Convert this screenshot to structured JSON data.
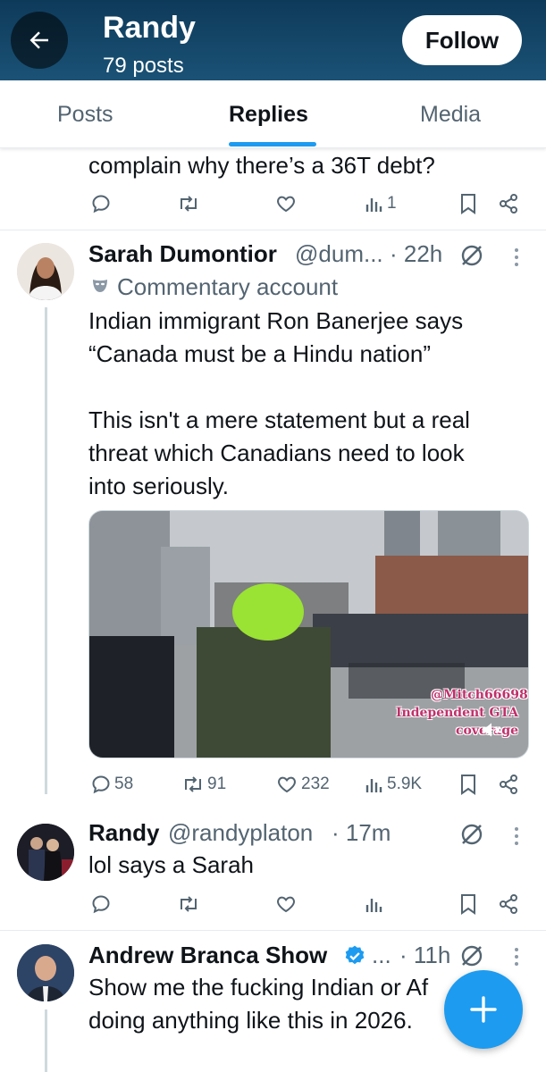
{
  "header": {
    "name": "Randy",
    "posts_count": "79 posts",
    "follow_label": "Follow",
    "back_icon": "arrow-left-icon"
  },
  "tabs": [
    {
      "label": "Posts",
      "active": false
    },
    {
      "label": "Replies",
      "active": true
    },
    {
      "label": "Media",
      "active": false
    }
  ],
  "previous_tweet": {
    "text_tail": "complain why there’s a 36T debt?",
    "views": "1"
  },
  "tweet_sarah": {
    "name": "Sarah Dumontior",
    "handle": "@dum...",
    "time": "· 22h",
    "label_text": "Commentary account",
    "lines": [
      "Indian immigrant Ron Banerjee says",
      "“Canada must be a Hindu nation”",
      "",
      "This isn't a mere statement but a real",
      "threat which Canadians need to look",
      "into seriously."
    ],
    "media_watermark": [
      "@Mitch66698·",
      "Independent GTA",
      "coverage"
    ],
    "replies": "58",
    "reposts": "91",
    "likes": "232",
    "views": "5.9K"
  },
  "tweet_randy": {
    "name": "Randy",
    "handle": "@randyplaton",
    "time": "· 17m",
    "text": "lol says a Sarah"
  },
  "tweet_andrew": {
    "name": "Andrew Branca Show",
    "handle": "...",
    "time": "· 11h",
    "lines": [
      "Show me the fucking Indian or Af",
      "doing anything like this in 2026."
    ]
  },
  "colors": {
    "accent": "#1d9bf0",
    "header_bg": "#1a5276",
    "muted_text": "#536471",
    "thread_line": "#cfd9de"
  }
}
